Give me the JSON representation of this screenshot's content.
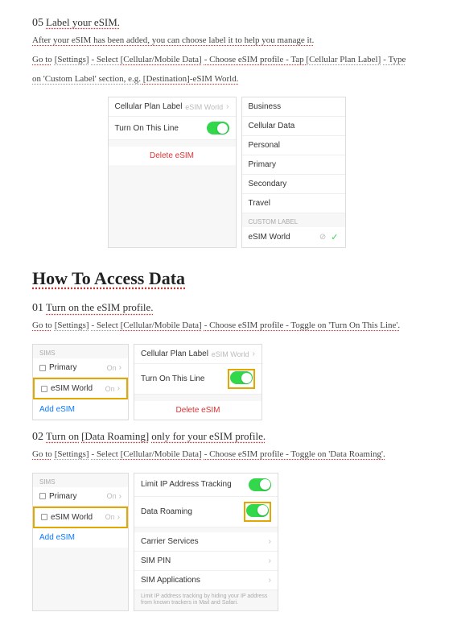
{
  "step05": {
    "num": "05",
    "title": "Label your eSIM.",
    "line1a": "After your eSIM has been added, you can choose label it to help you manage it.",
    "line2_goto": "Go to",
    "line2_settings": "[Settings]",
    "line2_select": " - Select ",
    "line2_cell": "[Cellular/Mobile Data]",
    "line2_choose": " - Choose eSIM profile - Tap ",
    "line2_plan": "[Cellular Plan Label]",
    "line2_type": " - Type",
    "line3a": "on 'Custom Label' section, e.g. ",
    "line3b": "[Destination]-eSIM World."
  },
  "shot05": {
    "left": {
      "row1_label": "Cellular Plan Label",
      "row1_value": "eSIM World",
      "row2_label": "Turn On This Line",
      "delete": "Delete eSIM"
    },
    "right": {
      "items": [
        "Business",
        "Cellular Data",
        "Personal",
        "Primary",
        "Secondary",
        "Travel"
      ],
      "custom_header": "CUSTOM LABEL",
      "custom_value": "eSIM World"
    }
  },
  "header_access": "How To Access Data",
  "step01": {
    "num": "01",
    "title": "Turn on the eSIM profile.",
    "goto": "Go to",
    "settings": "[Settings]",
    "select": " - Select ",
    "cell": "[Cellular/Mobile Data]",
    "rest": " - Choose eSIM profile - Toggle on 'Turn On This Line'."
  },
  "shot01": {
    "left": {
      "sims_header": "SIMs",
      "primary": "Primary",
      "esim": "eSIM World",
      "on": "On",
      "add": "Add eSIM"
    },
    "right": {
      "row1_label": "Cellular Plan Label",
      "row1_value": "eSIM World",
      "row2_label": "Turn On This Line",
      "delete": "Delete eSIM"
    }
  },
  "step02": {
    "num": "02",
    "title_a": "Turn on",
    "title_b": "[Data Roaming]",
    "title_c": "only for your eSIM profile.",
    "goto": "Go to",
    "settings": "[Settings]",
    "select": " - Select ",
    "cell": "[Cellular/Mobile Data]",
    "rest": " - Choose eSIM profile - Toggle on 'Data Roaming'."
  },
  "shot02": {
    "left": {
      "sims_header": "SIMs",
      "primary": "Primary",
      "esim": "eSIM World",
      "on": "On",
      "add": "Add eSIM"
    },
    "right": {
      "r1": "Limit IP Address Tracking",
      "r2": "Data Roaming",
      "r3": "Carrier Services",
      "r4": "SIM PIN",
      "r5": "SIM Applications",
      "fine": "Limit IP address tracking by hiding your IP address from known trackers in Mail and Safari."
    }
  }
}
